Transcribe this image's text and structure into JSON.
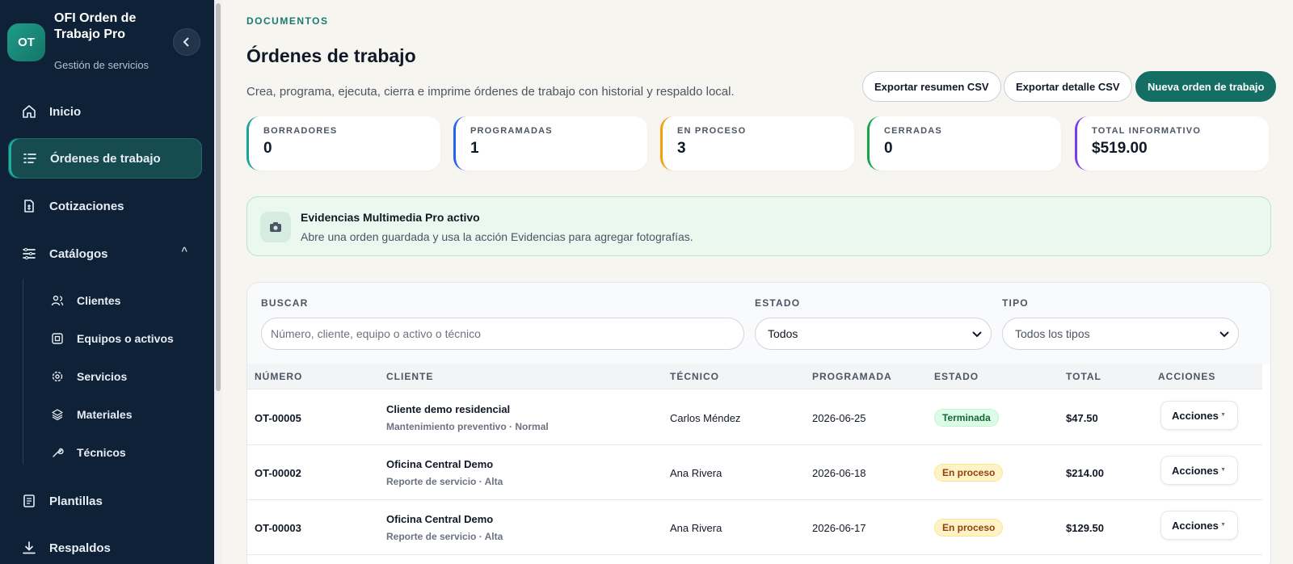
{
  "sidebar": {
    "logo_text": "OT",
    "brand_title": "OFI Orden de Trabajo Pro",
    "brand_subtitle": "Gestión de servicios",
    "collapse_icon": "chevron-left-icon",
    "items": [
      {
        "label": "Inicio",
        "icon": "home-icon"
      },
      {
        "label": "Órdenes de trabajo",
        "icon": "list-icon",
        "active": true
      },
      {
        "label": "Cotizaciones",
        "icon": "document-icon"
      },
      {
        "label": "Catálogos",
        "icon": "catalog-icon",
        "caret": "^"
      },
      {
        "label": "Plantillas",
        "icon": "template-icon"
      },
      {
        "label": "Respaldos",
        "icon": "download-icon"
      }
    ],
    "catalog_items": [
      {
        "label": "Clientes",
        "icon": "users-icon"
      },
      {
        "label": "Equipos o activos",
        "icon": "asset-icon"
      },
      {
        "label": "Servicios",
        "icon": "gear-icon"
      },
      {
        "label": "Materiales",
        "icon": "layers-icon"
      },
      {
        "label": "Técnicos",
        "icon": "wrench-icon"
      }
    ]
  },
  "header": {
    "eyebrow": "DOCUMENTOS",
    "title": "Órdenes de trabajo",
    "description": "Crea, programa, ejecuta, cierra e imprime órdenes de trabajo con historial y respaldo local.",
    "buttons": {
      "export_summary": "Exportar resumen CSV",
      "export_detail": "Exportar detalle CSV",
      "new_order": "Nueva orden de trabajo"
    }
  },
  "stats": [
    {
      "label": "BORRADORES",
      "value": "0",
      "color": "#1aa39a"
    },
    {
      "label": "PROGRAMADAS",
      "value": "1",
      "color": "#2563eb"
    },
    {
      "label": "EN PROCESO",
      "value": "3",
      "color": "#f59e0b"
    },
    {
      "label": "CERRADAS",
      "value": "0",
      "color": "#16a34a"
    },
    {
      "label": "TOTAL INFORMATIVO",
      "value": "$519.00",
      "color": "#7c3aed"
    }
  ],
  "notice": {
    "icon": "camera-icon",
    "title": "Evidencias Multimedia Pro activo",
    "text": "Abre una orden guardada y usa la acción Evidencias para agregar fotografías."
  },
  "filters": {
    "search_label": "BUSCAR",
    "search_placeholder": "Número, cliente, equipo o activo o técnico",
    "status_label": "ESTADO",
    "status_value": "Todos",
    "type_label": "TIPO",
    "type_value": "Todos los tipos"
  },
  "table": {
    "columns": [
      "NÚMERO",
      "CLIENTE",
      "TÉCNICO",
      "PROGRAMADA",
      "ESTADO",
      "TOTAL",
      "ACCIONES"
    ],
    "rows": [
      {
        "numero": "OT-00005",
        "cliente": "Cliente demo residencial",
        "detalle": "Mantenimiento preventivo · Normal",
        "tecnico": "Carlos Méndez",
        "programada": "2026-06-25",
        "estado": "Terminada",
        "total": "$47.50",
        "acciones": "Acciones"
      },
      {
        "numero": "OT-00002",
        "cliente": "Oficina Central Demo",
        "detalle": "Reporte de servicio · Alta",
        "tecnico": "Ana Rivera",
        "programada": "2026-06-18",
        "estado": "En proceso",
        "total": "$214.00",
        "acciones": "Acciones"
      },
      {
        "numero": "OT-00003",
        "cliente": "Oficina Central Demo",
        "detalle": "Reporte de servicio · Alta",
        "tecnico": "Ana Rivera",
        "programada": "2026-06-17",
        "estado": "En proceso",
        "total": "$129.50",
        "acciones": "Acciones"
      }
    ]
  }
}
